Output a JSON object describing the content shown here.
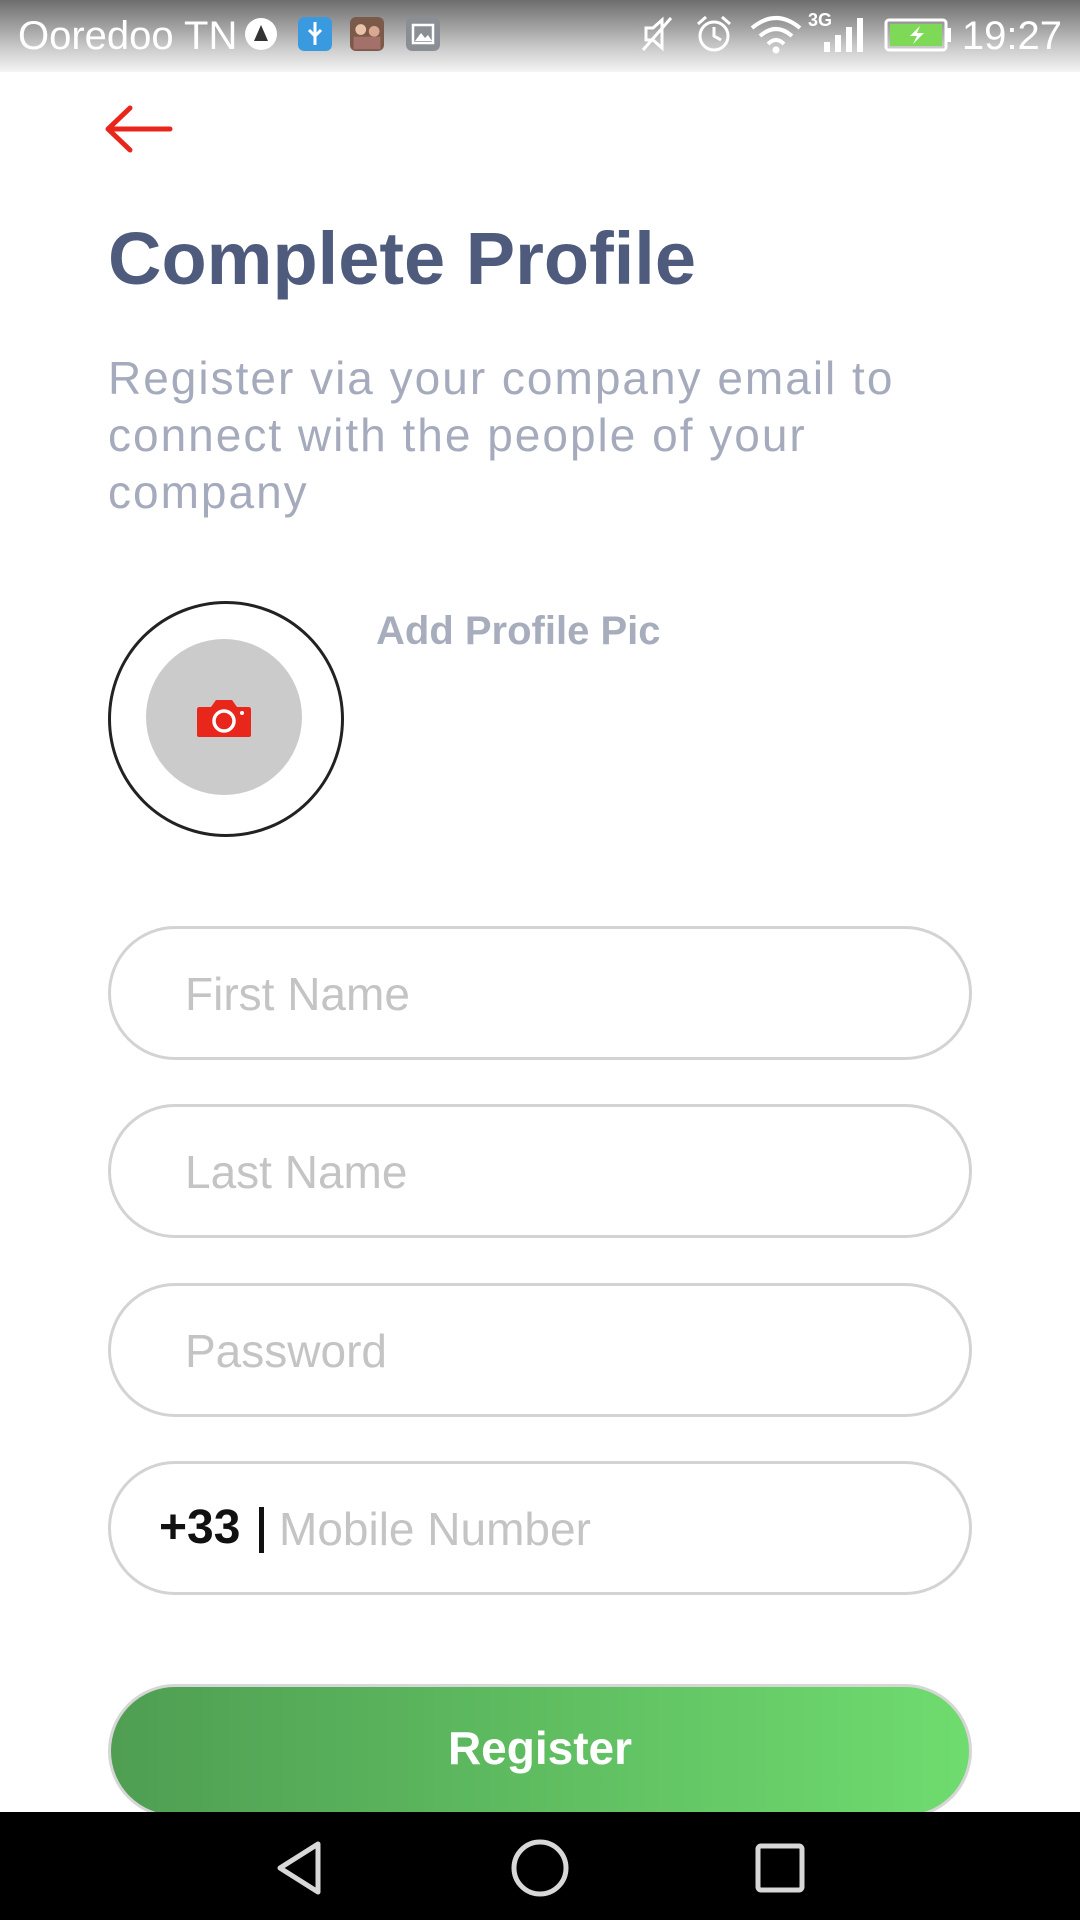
{
  "status_bar": {
    "carrier": "Ooredoo TN",
    "network_type": "3G",
    "time": "19:27",
    "icons": [
      "notification-app-icon",
      "usb-icon",
      "photo-thumbnail-icon",
      "gallery-icon",
      "mute-icon",
      "alarm-icon",
      "wifi-icon",
      "signal-icon",
      "battery-charging-icon"
    ]
  },
  "header": {
    "back_icon": "arrow-left-icon",
    "title": "Complete Profile",
    "subtitle": "Register via your company email to connect with the people of your company"
  },
  "profile_pic": {
    "label": "Add Profile Pic",
    "icon": "camera-icon"
  },
  "form": {
    "first_name": {
      "placeholder": "First Name",
      "value": ""
    },
    "last_name": {
      "placeholder": "Last Name",
      "value": ""
    },
    "password": {
      "placeholder": "Password",
      "value": ""
    },
    "mobile": {
      "prefix": "+33",
      "placeholder": "Mobile Number",
      "value": ""
    }
  },
  "actions": {
    "register_label": "Register"
  },
  "colors": {
    "accent_red": "#e8261b",
    "title": "#4f5b7c",
    "subtitle": "#a5abbd",
    "button_gradient_start": "#4f9e52",
    "button_gradient_end": "#6fdc6f"
  },
  "nav_bar": {
    "buttons": [
      "back-icon",
      "home-icon",
      "recents-icon"
    ]
  }
}
